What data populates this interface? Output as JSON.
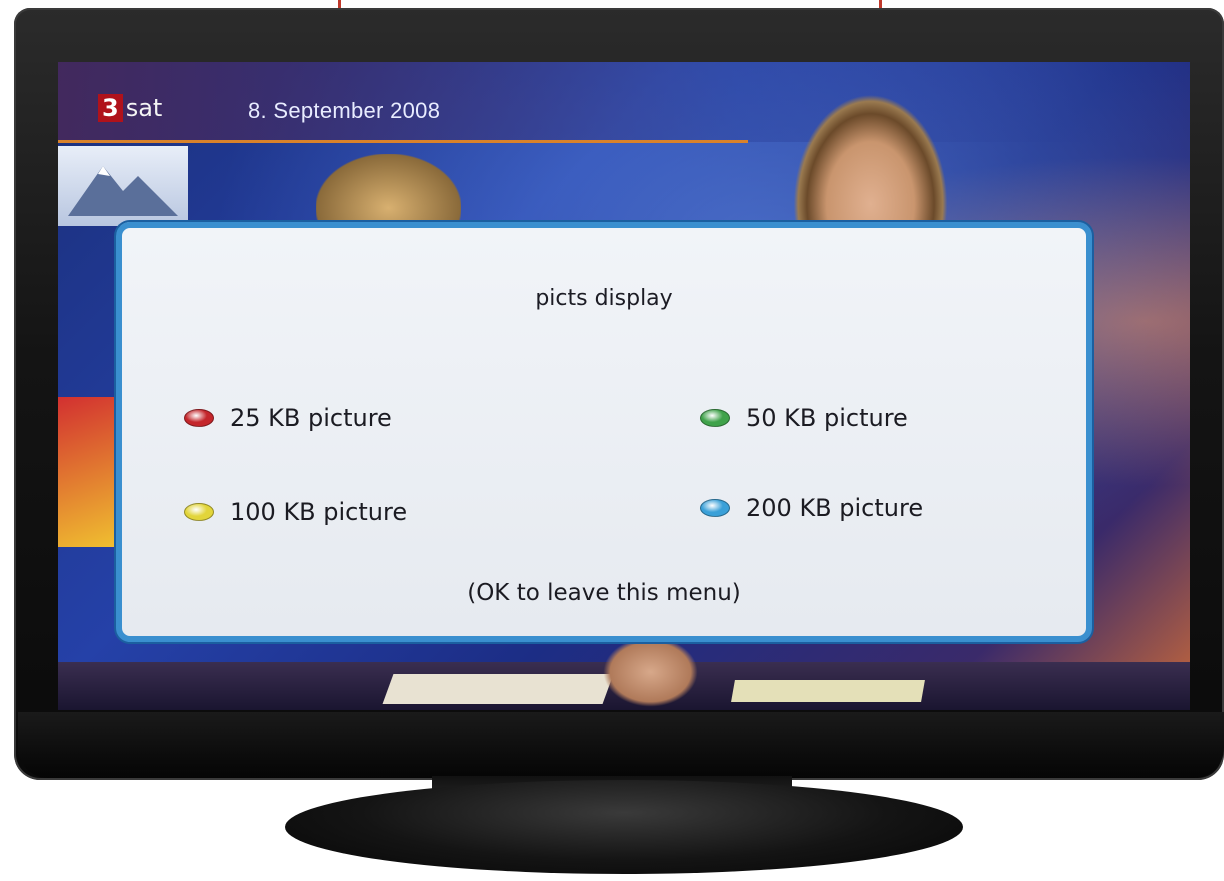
{
  "channel": {
    "logo_number": "3",
    "logo_text": "sat",
    "date": "8. September 2008"
  },
  "dialog": {
    "title": "picts display",
    "options": [
      {
        "label": "25 KB picture",
        "color": "#c4262b"
      },
      {
        "label": "50 KB picture",
        "color": "#3fa24a"
      },
      {
        "label": "100 KB picture",
        "color": "#e2d53a"
      },
      {
        "label": "200 KB picture",
        "color": "#3aa0d8"
      }
    ],
    "footer_hint": "(OK to leave this menu)"
  }
}
